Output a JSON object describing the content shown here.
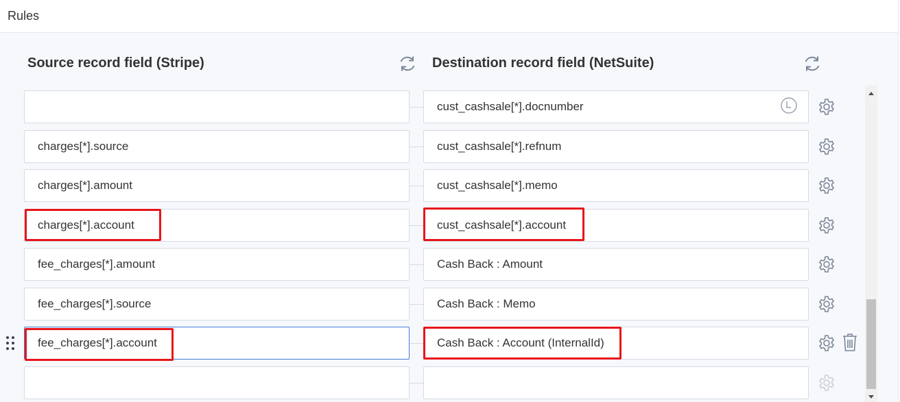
{
  "header": {
    "title": "Rules"
  },
  "columns": {
    "source_title": "Source record field (Stripe)",
    "destination_title": "Destination record field (NetSuite)"
  },
  "rows": [
    {
      "source": "",
      "destination": "cust_cashsale[*].docnumber"
    },
    {
      "source": "charges[*].source",
      "destination": "cust_cashsale[*].refnum"
    },
    {
      "source": "charges[*].amount",
      "destination": "cust_cashsale[*].memo"
    },
    {
      "source": "charges[*].account",
      "destination": "cust_cashsale[*].account"
    },
    {
      "source": "fee_charges[*].amount",
      "destination": "Cash Back : Amount"
    },
    {
      "source": "fee_charges[*].source",
      "destination": "Cash Back : Memo"
    },
    {
      "source": "fee_charges[*].account",
      "destination": "Cash Back : Account (InternalId)"
    },
    {
      "source": "",
      "destination": ""
    }
  ],
  "icons": {
    "refresh": "refresh-icon",
    "settings": "gear-icon",
    "delete": "trash-icon",
    "drag": "drag-handle-icon",
    "lookup": "clock-icon"
  },
  "colors": {
    "highlight": "#e8141a",
    "active_border": "#3d7bd4",
    "icon": "#7a8696"
  }
}
